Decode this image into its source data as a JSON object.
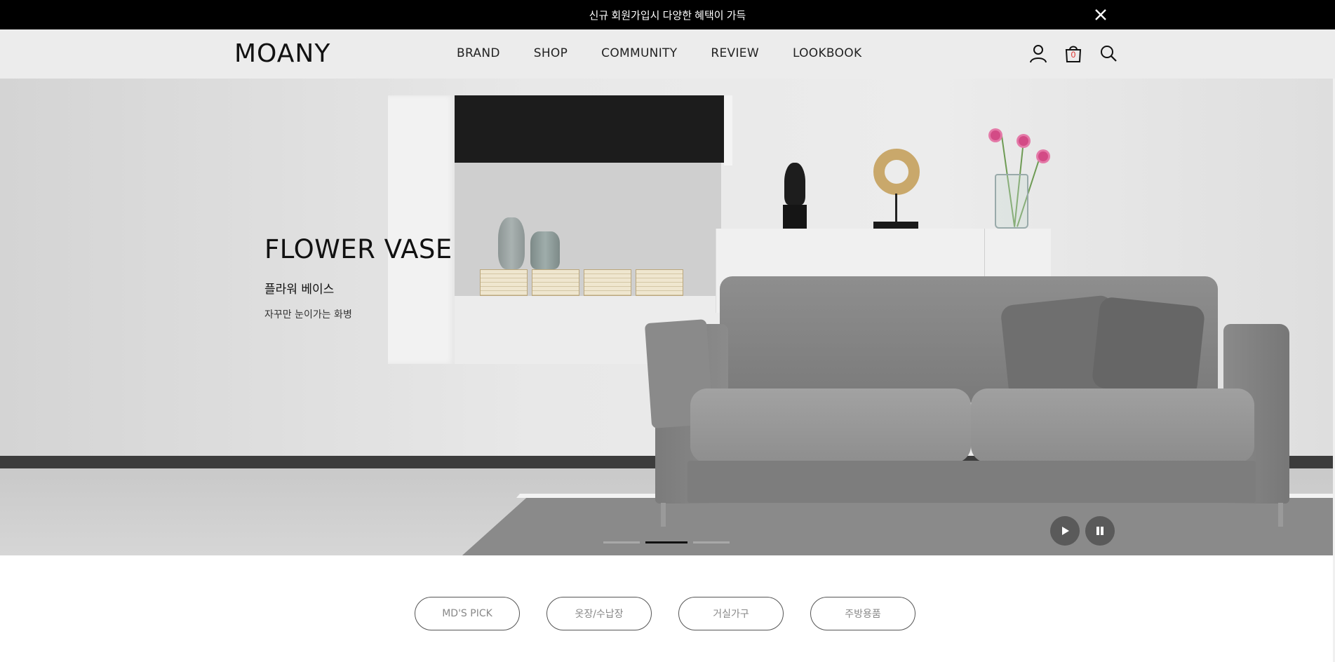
{
  "promo": {
    "text": "신규 회원가입시 다양한 혜택이 가득"
  },
  "header": {
    "logo": "MOANY",
    "nav": [
      "BRAND",
      "SHOP",
      "COMMUNITY",
      "REVIEW",
      "LOOKBOOK"
    ],
    "cart_count": "0",
    "icons": [
      "user-icon",
      "cart-icon",
      "search-icon"
    ]
  },
  "hero": {
    "title": "FLOWER VASE",
    "subtitle": "플라워 베이스",
    "description": "자꾸만 눈이가는 화병",
    "slides_total": 3,
    "active_slide": 2,
    "controls": [
      "play-icon",
      "pause-icon"
    ]
  },
  "categories": [
    "MD'S PICK",
    "옷장/수납장",
    "거실가구",
    "주방용품"
  ],
  "colors": {
    "promo_bg": "#000000",
    "header_bg": "#ebebeb",
    "cart_badge": "#e0302b",
    "text": "#111111"
  }
}
